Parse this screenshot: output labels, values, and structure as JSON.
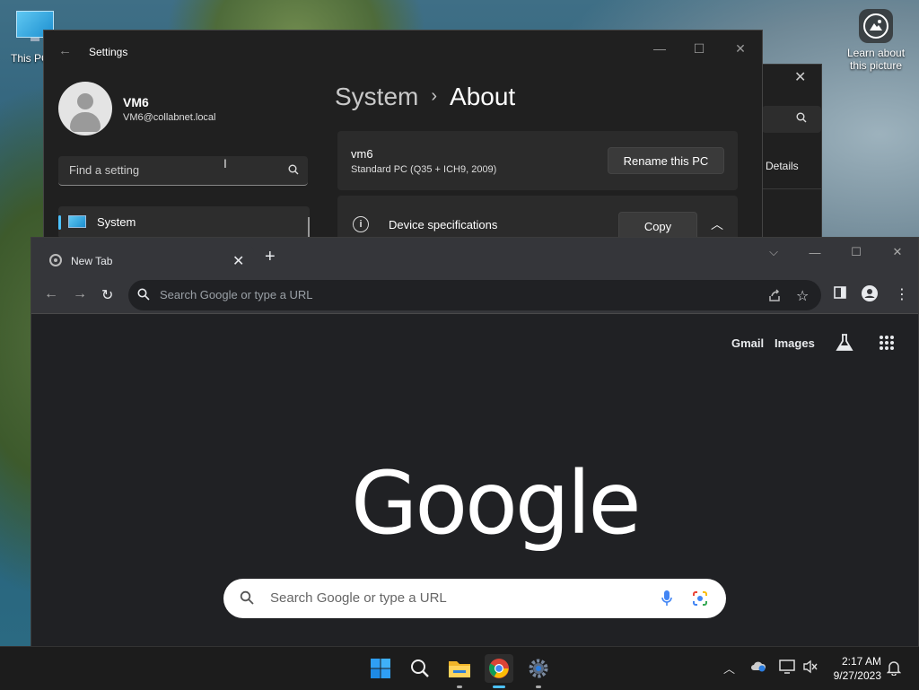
{
  "desktop": {
    "this_pc_label": "This PC",
    "learn_label": "Learn about this picture"
  },
  "settings_back": {
    "details_label": "Details"
  },
  "settings": {
    "title": "Settings",
    "user": {
      "name": "VM6",
      "email": "VM6@collabnet.local"
    },
    "search": {
      "placeholder": "Find a setting"
    },
    "nav": {
      "system_label": "System"
    },
    "breadcrumb": {
      "parent": "System",
      "separator": "›",
      "current": "About"
    },
    "pc": {
      "name": "vm6",
      "description": "Standard PC (Q35 + ICH9, 2009)",
      "rename_label": "Rename this PC"
    },
    "device_specs": {
      "label": "Device specifications",
      "copy_label": "Copy"
    }
  },
  "chrome": {
    "tab_title": "New Tab",
    "omnibox_placeholder": "Search Google or type a URL",
    "ntp": {
      "gmail_label": "Gmail",
      "images_label": "Images",
      "logo": "Google",
      "search_placeholder": "Search Google or type a URL"
    }
  },
  "taskbar": {
    "time": "2:17 AM",
    "date": "9/27/2023"
  },
  "colors": {
    "accent": "#4cc2ff",
    "settings_bg": "#202020",
    "chrome_bg": "#202124",
    "taskbar_bg": "#1c1c1c"
  }
}
